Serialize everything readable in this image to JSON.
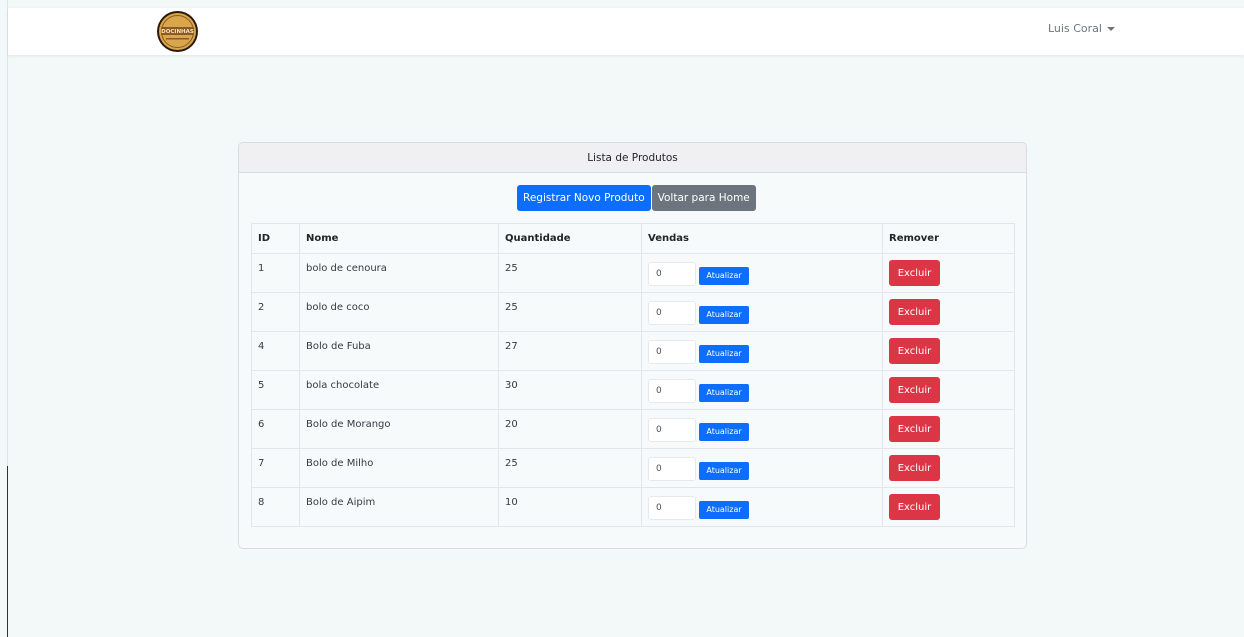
{
  "navbar": {
    "logo_text": "DOCINHAS",
    "user_name": "Luis Coral"
  },
  "card": {
    "title": "Lista de Produtos",
    "register_label": "Registrar Novo Produto",
    "home_label": "Voltar para Home"
  },
  "table": {
    "headers": [
      "ID",
      "Nome",
      "Quantidade",
      "Vendas",
      "Remover"
    ],
    "rows": [
      {
        "id": "1",
        "nome": "bolo de cenoura",
        "quantidade": "25",
        "vendas": "0"
      },
      {
        "id": "2",
        "nome": "bolo de coco",
        "quantidade": "25",
        "vendas": "0"
      },
      {
        "id": "4",
        "nome": "Bolo de Fuba",
        "quantidade": "27",
        "vendas": "0"
      },
      {
        "id": "5",
        "nome": "bola chocolate",
        "quantidade": "30",
        "vendas": "0"
      },
      {
        "id": "6",
        "nome": "Bolo de Morango",
        "quantidade": "20",
        "vendas": "0"
      },
      {
        "id": "7",
        "nome": "Bolo de Milho",
        "quantidade": "25",
        "vendas": "0"
      },
      {
        "id": "8",
        "nome": "Bolo de Aipim",
        "quantidade": "10",
        "vendas": "0"
      }
    ],
    "update_label": "Atualizar",
    "delete_label": "Excluir"
  },
  "colors": {
    "primary": "#0d6efd",
    "secondary": "#6c757d",
    "danger": "#dc3545",
    "background": "#f3f8f9",
    "logo_brown": "#8b5a22",
    "logo_gold": "#d9a64b"
  },
  "icons": {
    "user_menu": "caret-down-icon",
    "logo": "bakery-logo-icon"
  }
}
